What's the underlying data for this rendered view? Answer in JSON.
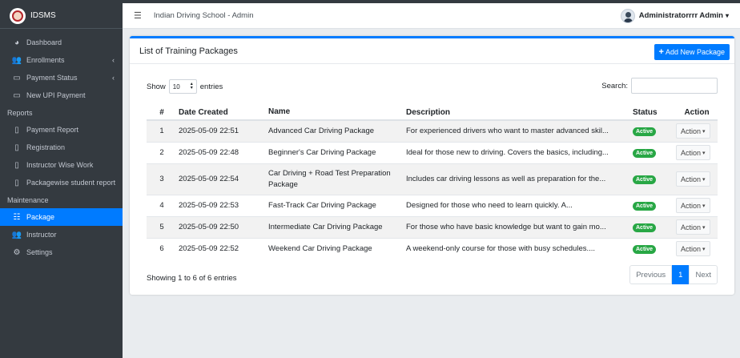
{
  "brand": {
    "name": "IDSMS"
  },
  "sidebar": {
    "items": [
      {
        "label": "Dashboard",
        "icon": "dashboard-icon",
        "glyph": "◕"
      },
      {
        "label": "Enrollments",
        "icon": "users-icon",
        "glyph": "👥",
        "caret": "‹"
      },
      {
        "label": "Payment Status",
        "icon": "money-icon",
        "glyph": "▭",
        "caret": "‹"
      },
      {
        "label": "New UPI Payment",
        "icon": "money-icon",
        "glyph": "▭"
      }
    ],
    "reports_header": "Reports",
    "reports": [
      {
        "label": "Payment Report",
        "icon": "file-icon",
        "glyph": "▯"
      },
      {
        "label": "Registration",
        "icon": "file-icon",
        "glyph": "▯"
      },
      {
        "label": "Instructor Wise Work",
        "icon": "file-icon",
        "glyph": "▯"
      },
      {
        "label": "Packagewise student report",
        "icon": "file-icon",
        "glyph": "▯"
      }
    ],
    "maintenance_header": "Maintenance",
    "maintenance": [
      {
        "label": "Package",
        "icon": "table-icon",
        "glyph": "☷",
        "active": true
      },
      {
        "label": "Instructor",
        "icon": "users-cog-icon",
        "glyph": "👥"
      },
      {
        "label": "Settings",
        "icon": "cogs-icon",
        "glyph": "⚙"
      }
    ]
  },
  "topnav": {
    "menu_glyph": "☰",
    "title": "Indian Driving School - Admin",
    "user": "Administratorrrr Admin",
    "user_caret": "▾"
  },
  "card": {
    "title": "List of Training Packages",
    "add_button": "Add New Package",
    "add_glyph": "+"
  },
  "table_controls": {
    "show": "Show",
    "entries_value": "10",
    "entries": "entries",
    "search": "Search:"
  },
  "table": {
    "headers": [
      "#",
      "Date Created",
      "Name",
      "Description",
      "Status",
      "Action"
    ],
    "rows": [
      {
        "num": "1",
        "date": "2025-05-09 22:51",
        "name": "Advanced Car Driving Package",
        "desc": "For experienced drivers who want to master advanced skil...",
        "status": "Active",
        "action": "Action"
      },
      {
        "num": "2",
        "date": "2025-05-09 22:48",
        "name": "Beginner's Car Driving Package",
        "desc": "Ideal for those new to driving. Covers the basics, including...",
        "status": "Active",
        "action": "Action"
      },
      {
        "num": "3",
        "date": "2025-05-09 22:54",
        "name": "Car Driving + Road Test Preparation Package",
        "desc": "Includes car driving lessons as well as preparation for the...",
        "status": "Active",
        "action": "Action"
      },
      {
        "num": "4",
        "date": "2025-05-09 22:53",
        "name": "Fast-Track Car Driving Package",
        "desc": "Designed for those who need to learn quickly. A...",
        "status": "Active",
        "action": "Action"
      },
      {
        "num": "5",
        "date": "2025-05-09 22:50",
        "name": "Intermediate Car Driving Package",
        "desc": "For those who have basic knowledge but want to gain mo...",
        "status": "Active",
        "action": "Action"
      },
      {
        "num": "6",
        "date": "2025-05-09 22:52",
        "name": "Weekend Car Driving Package",
        "desc": "A weekend-only course for those with busy schedules....",
        "status": "Active",
        "action": "Action"
      }
    ]
  },
  "footer": {
    "info": "Showing 1 to 6 of 6 entries",
    "prev": "Previous",
    "page": "1",
    "next": "Next"
  },
  "colors": {
    "sidebar": "#343a40",
    "accent": "#007bff",
    "active_badge": "#28a745"
  }
}
